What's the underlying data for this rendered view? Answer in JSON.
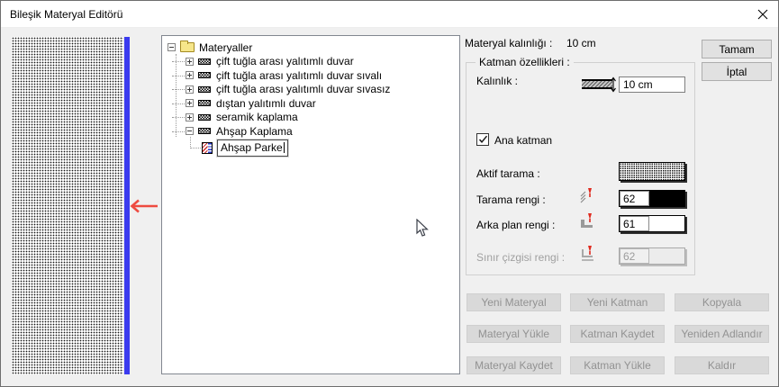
{
  "window": {
    "title": "Bileşik Materyal Editörü"
  },
  "tree": {
    "root": {
      "label": "Materyaller",
      "expanded": true
    },
    "items": [
      {
        "label": "çift tuğla arası yalıtımlı duvar",
        "expanded": false
      },
      {
        "label": "çift tuğla arası yalıtımlı duvar sıvalı",
        "expanded": false
      },
      {
        "label": "çift tuğla arası yalıtımlı duvar sıvasız",
        "expanded": false
      },
      {
        "label": "dıştan yalıtımlı duvar",
        "expanded": false
      },
      {
        "label": "seramik kaplama",
        "expanded": false
      },
      {
        "label": "Ahşap Kaplama",
        "expanded": true
      }
    ],
    "edit_item": {
      "value": "Ahşap Parke",
      "editing": true
    }
  },
  "properties": {
    "material_thickness_label": "Materyal kalınlığı :",
    "material_thickness_value": "10 cm",
    "group_label": "Katman özellikleri :",
    "thickness_label": "Kalınlık :",
    "thickness_value": "10 cm",
    "main_layer_label": "Ana katman",
    "main_layer_checked": true,
    "active_hatch_label": "Aktif tarama :",
    "hatch_color_label": "Tarama rengi :",
    "hatch_color_value": "62",
    "hatch_color_swatch": "#000000",
    "bg_color_label": "Arka plan rengi :",
    "bg_color_value": "61",
    "bg_color_swatch": "#ffffff",
    "border_color_label": "Sınır çizgisi rengi :",
    "border_color_value": "62",
    "border_color_swatch": "#ececec",
    "border_color_enabled": false
  },
  "buttons": {
    "ok": "Tamam",
    "cancel": "İptal",
    "grid": [
      "Yeni Materyal",
      "Yeni Katman",
      "Kopyala",
      "Materyal Yükle",
      "Katman Kaydet",
      "Yeniden Adlandır",
      "Materyal Kaydet",
      "Katman Yükle",
      "Kaldır"
    ]
  },
  "colors": {
    "accent_blue": "#3b3bee",
    "arrow_red": "#ee4b40",
    "titlebar_bg": "#ffffff",
    "dialog_bg": "#f0f0f0"
  }
}
